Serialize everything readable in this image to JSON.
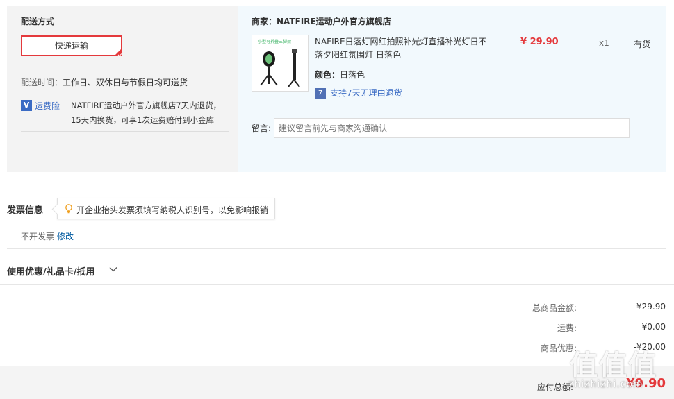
{
  "shipping": {
    "section_title": "配送方式",
    "option_label": "快递运输",
    "delivery_time_label": "配送时间：",
    "delivery_time_value": "工作日、双休日与节假日均可送货",
    "insurance_label": "运费险",
    "insurance_text": "NATFIRE运动户外官方旗舰店7天内退货，15天内换货，可享1次运费赔付到小金库"
  },
  "merchant": {
    "label": "商家：NATFIRE运动户外官方旗舰店"
  },
  "product": {
    "thumb_caption": "小型可折叠三脚架",
    "name": "NAFIRE日落灯网红拍照补光灯直播补光灯日不落夕阳红氛围灯 日落色",
    "price": "¥ 29.90",
    "quantity": "x1",
    "stock": "有货",
    "color_label": "颜色：",
    "color_value": "日落色",
    "return_icon": "7",
    "return_policy": "支持7天无理由退货"
  },
  "note": {
    "label": "留言:",
    "placeholder": "建议留言前先与商家沟通确认"
  },
  "invoice": {
    "title": "发票信息",
    "tip": "开企业抬头发票须填写纳税人识别号，以免影响报销",
    "status": "不开发票",
    "edit_label": "修改"
  },
  "coupon": {
    "label": "使用优惠/礼品卡/抵用"
  },
  "summary": {
    "total_label": "总商品金额:",
    "total_value": "¥29.90",
    "shipping_label": "运费:",
    "shipping_value": "¥0.00",
    "discount_label": "商品优惠:",
    "discount_value": "-¥20.00",
    "payable_label": "应付总额:",
    "payable_value": "¥9.90"
  },
  "watermark": {
    "logo": "值值值",
    "domain": "zhizhizhi.com"
  },
  "colors": {
    "accent": "#e4393c",
    "link": "#005aa0",
    "insurance_blue": "#3a6bc4"
  }
}
